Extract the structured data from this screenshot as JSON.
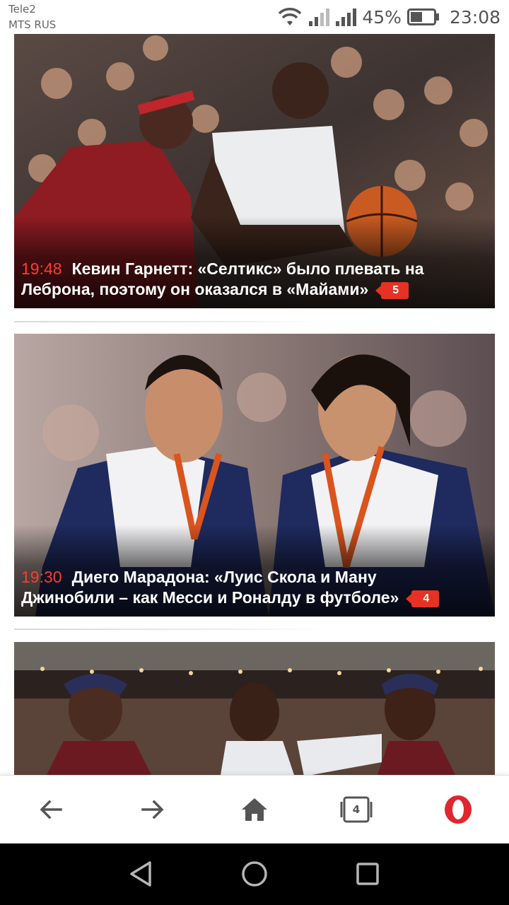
{
  "status_bar": {
    "carrier_1": "Tele2",
    "carrier_2": "MTS RUS",
    "battery_percent": "45%",
    "time": "23:08",
    "icons": [
      "wifi-icon",
      "signal-icon",
      "signal-icon",
      "battery-icon"
    ]
  },
  "feed": {
    "articles": [
      {
        "time": "19:48",
        "headline": "Кевин Гарнетт: «Селтикс» было плевать на Леброна, поэтому он оказался в «Майами»",
        "comments": "5"
      },
      {
        "time": "19:30",
        "headline": "Диего Марадона: «Луис Скола и Ману Джинобили – как Месси и Роналду в футболе»",
        "comments": "4"
      }
    ]
  },
  "browser_toolbar": {
    "tabs_count": "4",
    "icons": [
      "back-arrow-icon",
      "forward-arrow-icon",
      "home-icon",
      "tabs-icon",
      "opera-logo-icon"
    ]
  },
  "colors": {
    "time_accent": "#ff3b30",
    "badge": "#e53222",
    "opera_red": "#e0262e"
  }
}
